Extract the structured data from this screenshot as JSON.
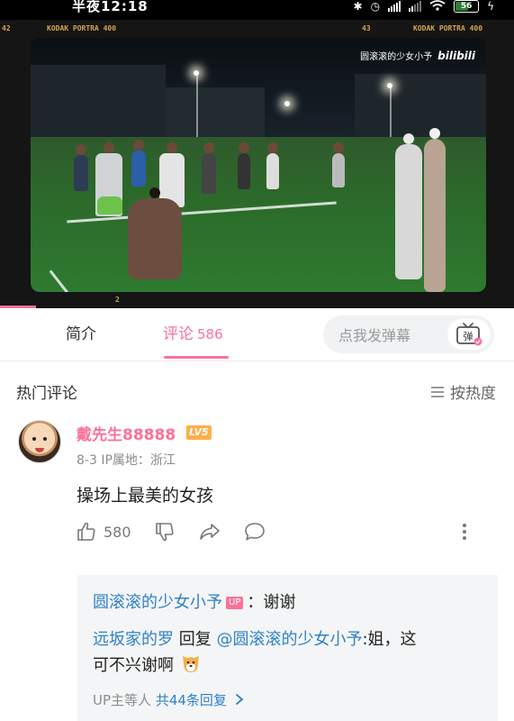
{
  "status_bar": {
    "time": "半夜12:18",
    "battery": "56"
  },
  "video": {
    "film_left_top": "KODAK PORTRA 400",
    "film_right_num": "43",
    "film_right_top": "KODAK PORTRA 400",
    "film_num_left": "42",
    "film_bottom_num": "2",
    "watermark_author": "圆滚滚的少女小予",
    "watermark_logo": "bilibili"
  },
  "tabs": {
    "intro_label": "简介",
    "comments_label": "评论",
    "comments_count": "586",
    "danmaku_placeholder": "点我发弹幕",
    "danmaku_toggle_label": "弹"
  },
  "hot": {
    "title": "热门评论",
    "sort_label": "按热度"
  },
  "comment": {
    "username": "戴先生88888",
    "level": "LV5",
    "meta": "8-3  IP属地：浙江",
    "text": "操场上最美的女孩",
    "likes": "580"
  },
  "replies": {
    "r1_name": "圆滚滚的少女小予",
    "r1_badge": "UP",
    "r1_text": "：谢谢",
    "r2_name": "远坂家的罗",
    "r2_reply_word": "回复",
    "r2_target": "@圆滚滚的少女小予",
    "r2_text": ":姐，这",
    "r2_text2": "可不兴谢啊",
    "more_prefix": "UP主等人",
    "more_link": "共44条回复"
  },
  "colors": {
    "accent_pink": "#fb7299",
    "link_blue": "#2f82c8",
    "level_orange": "#fdb049"
  }
}
